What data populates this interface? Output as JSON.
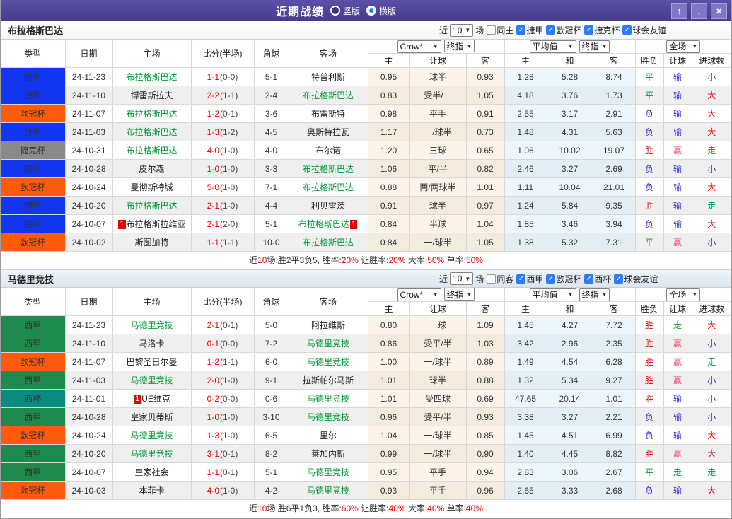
{
  "titlebar": {
    "title": "近期战绩",
    "layout_options": [
      {
        "label": "竖版",
        "selected": false
      },
      {
        "label": "横版",
        "selected": true
      }
    ],
    "buttons": {
      "up": "↑",
      "down": "↓",
      "close": "×"
    }
  },
  "filter_labels": {
    "near": "近",
    "games": "场"
  },
  "columns": {
    "type": "类型",
    "date": "日期",
    "home": "主场",
    "score": "比分(半场)",
    "corner": "角球",
    "away": "客场",
    "odds_group": {
      "bookmaker": "Crow*",
      "final": "终指"
    },
    "avg_group": {
      "label": "平均值",
      "final": "终指"
    },
    "full_group": {
      "label": "全场"
    },
    "sub": [
      "主",
      "让球",
      "客",
      "主",
      "和",
      "客",
      "胜负",
      "让球",
      "进球数"
    ]
  },
  "league_colors": {
    "捷甲": "#1236f0",
    "欧冠杯": "#ff5b0a",
    "捷克杯": "#8a8a8a",
    "西甲": "#1e8a4e",
    "西杯": "#0a8a80"
  },
  "result_colors": {
    "r": "#e60000",
    "p": "#f0486c",
    "g": "#009933",
    "b": "#3434d0"
  },
  "sections": [
    {
      "team": "布拉格斯巴达",
      "filter": {
        "count": "10",
        "same_venue": {
          "label": "同主",
          "checked": false
        },
        "leagues": [
          {
            "label": "捷甲",
            "checked": true
          },
          {
            "label": "欧冠杯",
            "checked": true
          },
          {
            "label": "捷克杯",
            "checked": true
          },
          {
            "label": "球会友谊",
            "checked": true
          }
        ]
      },
      "rows": [
        {
          "league": "捷甲",
          "date": "24-11-23",
          "home": {
            "name": "布拉格斯巴达",
            "green": true
          },
          "score": [
            "1-1",
            "(0-0)"
          ],
          "corners": "5-1",
          "away": {
            "name": "特普利斯",
            "green": false
          },
          "odds": [
            "0.95",
            "球半",
            "0.93"
          ],
          "avg": [
            "1.28",
            "5.28",
            "8.74"
          ],
          "result": [
            [
              "平",
              "g"
            ],
            [
              "输",
              "b"
            ],
            [
              "小",
              "b"
            ]
          ]
        },
        {
          "league": "捷甲",
          "date": "24-11-10",
          "home": {
            "name": "博雷斯拉夫",
            "green": false
          },
          "score": [
            "2-2",
            "(1-1)"
          ],
          "corners": "2-4",
          "away": {
            "name": "布拉格斯巴达",
            "green": true
          },
          "odds": [
            "0.83",
            "受半/一",
            "1.05"
          ],
          "avg": [
            "4.18",
            "3.76",
            "1.73"
          ],
          "result": [
            [
              "平",
              "g"
            ],
            [
              "输",
              "b"
            ],
            [
              "大",
              "r"
            ]
          ]
        },
        {
          "league": "欧冠杯",
          "date": "24-11-07",
          "home": {
            "name": "布拉格斯巴达",
            "green": true
          },
          "score": [
            "1-2",
            "(0-1)"
          ],
          "corners": "3-6",
          "away": {
            "name": "布雷斯特",
            "green": false
          },
          "odds": [
            "0.98",
            "平手",
            "0.91"
          ],
          "avg": [
            "2.55",
            "3.17",
            "2.91"
          ],
          "result": [
            [
              "负",
              "b"
            ],
            [
              "输",
              "b"
            ],
            [
              "大",
              "r"
            ]
          ]
        },
        {
          "league": "捷甲",
          "date": "24-11-03",
          "home": {
            "name": "布拉格斯巴达",
            "green": true
          },
          "score": [
            "1-3",
            "(1-2)"
          ],
          "corners": "4-5",
          "away": {
            "name": "奥斯特拉瓦",
            "green": false
          },
          "odds": [
            "1.17",
            "一/球半",
            "0.73"
          ],
          "avg": [
            "1.48",
            "4.31",
            "5.63"
          ],
          "result": [
            [
              "负",
              "b"
            ],
            [
              "输",
              "b"
            ],
            [
              "大",
              "r"
            ]
          ]
        },
        {
          "league": "捷克杯",
          "date": "24-10-31",
          "home": {
            "name": "布拉格斯巴达",
            "green": true
          },
          "score": [
            "4-0",
            "(1-0)"
          ],
          "corners": "4-0",
          "away": {
            "name": "布尔诺",
            "green": false
          },
          "odds": [
            "1.20",
            "三球",
            "0.65"
          ],
          "avg": [
            "1.06",
            "10.02",
            "19.07"
          ],
          "result": [
            [
              "胜",
              "r"
            ],
            [
              "赢",
              "p"
            ],
            [
              "走",
              "g"
            ]
          ]
        },
        {
          "league": "捷甲",
          "date": "24-10-28",
          "home": {
            "name": "皮尔森",
            "green": false
          },
          "score": [
            "1-0",
            "(1-0)"
          ],
          "corners": "3-3",
          "away": {
            "name": "布拉格斯巴达",
            "green": true
          },
          "odds": [
            "1.06",
            "平/半",
            "0.82"
          ],
          "avg": [
            "2.46",
            "3.27",
            "2.69"
          ],
          "result": [
            [
              "负",
              "b"
            ],
            [
              "输",
              "b"
            ],
            [
              "小",
              "b"
            ]
          ]
        },
        {
          "league": "欧冠杯",
          "date": "24-10-24",
          "home": {
            "name": "曼彻斯特城",
            "green": false
          },
          "score": [
            "5-0",
            "(1-0)"
          ],
          "corners": "7-1",
          "away": {
            "name": "布拉格斯巴达",
            "green": true
          },
          "odds": [
            "0.88",
            "两/两球半",
            "1.01"
          ],
          "avg": [
            "1.11",
            "10.04",
            "21.01"
          ],
          "result": [
            [
              "负",
              "b"
            ],
            [
              "输",
              "b"
            ],
            [
              "大",
              "r"
            ]
          ]
        },
        {
          "league": "捷甲",
          "date": "24-10-20",
          "home": {
            "name": "布拉格斯巴达",
            "green": true
          },
          "score": [
            "2-1",
            "(1-0)"
          ],
          "corners": "4-4",
          "away": {
            "name": "利贝雷茨",
            "green": false
          },
          "odds": [
            "0.91",
            "球半",
            "0.97"
          ],
          "avg": [
            "1.24",
            "5.84",
            "9.35"
          ],
          "result": [
            [
              "胜",
              "r"
            ],
            [
              "输",
              "b"
            ],
            [
              "走",
              "g"
            ]
          ]
        },
        {
          "league": "捷甲",
          "date": "24-10-07",
          "home": {
            "name": "布拉格斯拉维亚",
            "green": false,
            "badge_before": "1"
          },
          "score": [
            "2-1",
            "(2-0)"
          ],
          "corners": "5-1",
          "away": {
            "name": "布拉格斯巴达",
            "green": true,
            "badge_after": "1"
          },
          "odds": [
            "0.84",
            "半球",
            "1.04"
          ],
          "avg": [
            "1.85",
            "3.46",
            "3.94"
          ],
          "result": [
            [
              "负",
              "b"
            ],
            [
              "输",
              "b"
            ],
            [
              "大",
              "r"
            ]
          ]
        },
        {
          "league": "欧冠杯",
          "date": "24-10-02",
          "home": {
            "name": "斯图加特",
            "green": false
          },
          "score": [
            "1-1",
            "(1-1)"
          ],
          "corners": "10-0",
          "away": {
            "name": "布拉格斯巴达",
            "green": true
          },
          "odds": [
            "0.84",
            "一/球半",
            "1.05"
          ],
          "avg": [
            "1.38",
            "5.32",
            "7.31"
          ],
          "result": [
            [
              "平",
              "g"
            ],
            [
              "赢",
              "p"
            ],
            [
              "小",
              "b"
            ]
          ]
        }
      ],
      "summary": [
        [
          "近",
          0
        ],
        [
          "10",
          1
        ],
        [
          "场,胜2平3负5, 胜率:",
          0
        ],
        [
          "20%",
          1
        ],
        [
          " 让胜率:",
          0
        ],
        [
          "20%",
          1
        ],
        [
          " 大率:",
          0
        ],
        [
          "50%",
          1
        ],
        [
          " 单率:",
          0
        ],
        [
          "50%",
          1
        ]
      ]
    },
    {
      "team": "马德里竞技",
      "filter": {
        "count": "10",
        "same_venue": {
          "label": "同客",
          "checked": false
        },
        "leagues": [
          {
            "label": "西甲",
            "checked": true
          },
          {
            "label": "欧冠杯",
            "checked": true
          },
          {
            "label": "西杯",
            "checked": true
          },
          {
            "label": "球会友谊",
            "checked": true
          }
        ]
      },
      "rows": [
        {
          "league": "西甲",
          "date": "24-11-23",
          "home": {
            "name": "马德里竞技",
            "green": true
          },
          "score": [
            "2-1",
            "(0-1)"
          ],
          "corners": "5-0",
          "away": {
            "name": "阿拉维斯",
            "green": false
          },
          "odds": [
            "0.80",
            "一球",
            "1.09"
          ],
          "avg": [
            "1.45",
            "4.27",
            "7.72"
          ],
          "result": [
            [
              "胜",
              "r"
            ],
            [
              "走",
              "g"
            ],
            [
              "大",
              "r"
            ]
          ]
        },
        {
          "league": "西甲",
          "date": "24-11-10",
          "home": {
            "name": "马洛卡",
            "green": false
          },
          "score": [
            "0-1",
            "(0-0)"
          ],
          "corners": "7-2",
          "away": {
            "name": "马德里竞技",
            "green": true
          },
          "odds": [
            "0.86",
            "受平/半",
            "1.03"
          ],
          "avg": [
            "3.42",
            "2.96",
            "2.35"
          ],
          "result": [
            [
              "胜",
              "r"
            ],
            [
              "赢",
              "p"
            ],
            [
              "小",
              "b"
            ]
          ]
        },
        {
          "league": "欧冠杯",
          "date": "24-11-07",
          "home": {
            "name": "巴黎圣日尔曼",
            "green": false
          },
          "score": [
            "1-2",
            "(1-1)"
          ],
          "corners": "6-0",
          "away": {
            "name": "马德里竞技",
            "green": true
          },
          "odds": [
            "1.00",
            "一/球半",
            "0.89"
          ],
          "avg": [
            "1.49",
            "4.54",
            "6.28"
          ],
          "result": [
            [
              "胜",
              "r"
            ],
            [
              "赢",
              "p"
            ],
            [
              "走",
              "g"
            ]
          ]
        },
        {
          "league": "西甲",
          "date": "24-11-03",
          "home": {
            "name": "马德里竞技",
            "green": true
          },
          "score": [
            "2-0",
            "(1-0)"
          ],
          "corners": "9-1",
          "away": {
            "name": "拉斯帕尔马斯",
            "green": false
          },
          "odds": [
            "1.01",
            "球半",
            "0.88"
          ],
          "avg": [
            "1.32",
            "5.34",
            "9.27"
          ],
          "result": [
            [
              "胜",
              "r"
            ],
            [
              "赢",
              "p"
            ],
            [
              "小",
              "b"
            ]
          ]
        },
        {
          "league": "西杯",
          "date": "24-11-01",
          "home": {
            "name": "UE维克",
            "green": false,
            "badge_before": "1"
          },
          "score": [
            "0-2",
            "(0-0)"
          ],
          "corners": "0-6",
          "away": {
            "name": "马德里竞技",
            "green": true
          },
          "odds": [
            "1.01",
            "受四球",
            "0.69"
          ],
          "avg": [
            "47.65",
            "20.14",
            "1.01"
          ],
          "result": [
            [
              "胜",
              "r"
            ],
            [
              "输",
              "b"
            ],
            [
              "小",
              "b"
            ]
          ]
        },
        {
          "league": "西甲",
          "date": "24-10-28",
          "home": {
            "name": "皇家贝蒂斯",
            "green": false
          },
          "score": [
            "1-0",
            "(1-0)"
          ],
          "corners": "3-10",
          "away": {
            "name": "马德里竞技",
            "green": true
          },
          "odds": [
            "0.96",
            "受平/半",
            "0.93"
          ],
          "avg": [
            "3.38",
            "3.27",
            "2.21"
          ],
          "result": [
            [
              "负",
              "b"
            ],
            [
              "输",
              "b"
            ],
            [
              "小",
              "b"
            ]
          ]
        },
        {
          "league": "欧冠杯",
          "date": "24-10-24",
          "home": {
            "name": "马德里竞技",
            "green": true
          },
          "score": [
            "1-3",
            "(1-0)"
          ],
          "corners": "6-5",
          "away": {
            "name": "里尔",
            "green": false
          },
          "odds": [
            "1.04",
            "一/球半",
            "0.85"
          ],
          "avg": [
            "1.45",
            "4.51",
            "6.99"
          ],
          "result": [
            [
              "负",
              "b"
            ],
            [
              "输",
              "b"
            ],
            [
              "大",
              "r"
            ]
          ]
        },
        {
          "league": "西甲",
          "date": "24-10-20",
          "home": {
            "name": "马德里竞技",
            "green": true
          },
          "score": [
            "3-1",
            "(0-1)"
          ],
          "corners": "8-2",
          "away": {
            "name": "莱加内斯",
            "green": false
          },
          "odds": [
            "0.99",
            "一/球半",
            "0.90"
          ],
          "avg": [
            "1.40",
            "4.45",
            "8.82"
          ],
          "result": [
            [
              "胜",
              "r"
            ],
            [
              "赢",
              "p"
            ],
            [
              "大",
              "r"
            ]
          ]
        },
        {
          "league": "西甲",
          "date": "24-10-07",
          "home": {
            "name": "皇家社会",
            "green": false
          },
          "score": [
            "1-1",
            "(0-1)"
          ],
          "corners": "5-1",
          "away": {
            "name": "马德里竞技",
            "green": true
          },
          "odds": [
            "0.95",
            "平手",
            "0.94"
          ],
          "avg": [
            "2.83",
            "3.06",
            "2.67"
          ],
          "result": [
            [
              "平",
              "g"
            ],
            [
              "走",
              "g"
            ],
            [
              "走",
              "g"
            ]
          ]
        },
        {
          "league": "欧冠杯",
          "date": "24-10-03",
          "home": {
            "name": "本菲卡",
            "green": false
          },
          "score": [
            "4-0",
            "(1-0)"
          ],
          "corners": "4-2",
          "away": {
            "name": "马德里竞技",
            "green": true
          },
          "odds": [
            "0.93",
            "平手",
            "0.96"
          ],
          "avg": [
            "2.65",
            "3.33",
            "2.68"
          ],
          "result": [
            [
              "负",
              "b"
            ],
            [
              "输",
              "b"
            ],
            [
              "大",
              "r"
            ]
          ]
        }
      ],
      "summary": [
        [
          "近",
          0
        ],
        [
          "10",
          1
        ],
        [
          "场,胜6平1负3, 胜率:",
          0
        ],
        [
          "60%",
          1
        ],
        [
          " 让胜率:",
          0
        ],
        [
          "40%",
          1
        ],
        [
          " 大率:",
          0
        ],
        [
          "40%",
          1
        ],
        [
          " 单率:",
          0
        ],
        [
          "40%",
          1
        ]
      ]
    }
  ]
}
